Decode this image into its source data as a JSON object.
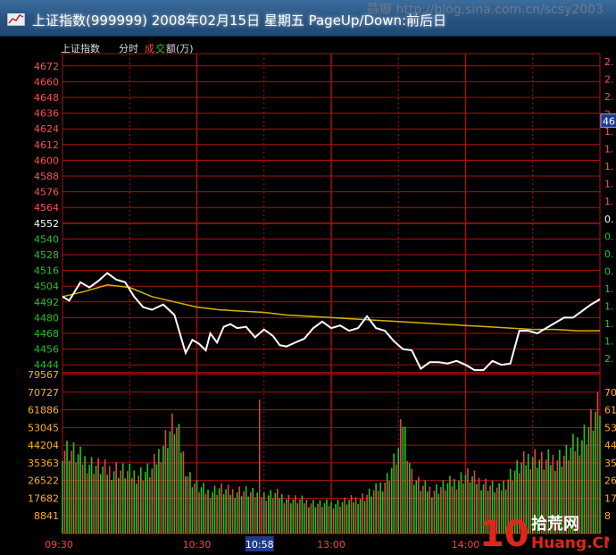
{
  "window": {
    "title": "上证指数(999999) 2008年02月15日 星期五 PageUp/Down:前后日",
    "watermark": "蒜瓣 http://blog.sina.com.cn/scsy2003"
  },
  "header": {
    "name": "上证指数",
    "mode": "分时",
    "vol_a": "成",
    "vol_b": "交",
    "vol_c": "额(万)"
  },
  "right_axis_fragments": {
    "price": [
      "2.",
      "2.",
      "2.",
      "2.",
      "1.",
      "1.",
      "1.",
      "1.",
      "1.",
      "0.",
      "0.",
      "0.",
      "0.",
      "1.",
      "1.",
      "1.",
      "1.",
      "2."
    ],
    "volume": [
      "70",
      "61",
      "53",
      "44",
      "35",
      "26",
      "17",
      "8"
    ],
    "price_badge": "46"
  },
  "logo": {
    "numeral": "10",
    "top": "拾荒网",
    "bottom": "Huang.CN"
  },
  "chart_data": {
    "type": "line",
    "price_axis_ticks": [
      4672,
      4660,
      4648,
      4636,
      4624,
      4612,
      4600,
      4588,
      4576,
      4564,
      4552,
      4540,
      4528,
      4516,
      4504,
      4492,
      4480,
      4468,
      4456,
      4444
    ],
    "reference_price": 4552,
    "volume_axis_ticks": [
      79567,
      70727,
      61886,
      53045,
      44204,
      35363,
      26522,
      17682,
      8841
    ],
    "time_labels": [
      "09:30",
      "10:30",
      "10:58",
      "13:00",
      "14:00"
    ],
    "highlighted_time": "10:58",
    "ylim_price": [
      4438,
      4678
    ],
    "ylim_volume": [
      0,
      79567
    ],
    "grid": true,
    "colors": {
      "background": "#000000",
      "grid": "#b01010",
      "price_line": "#ffffff",
      "average_line": "#d6b400",
      "volume_up": "#d84848",
      "volume_down": "#27c21e",
      "axis_up": "#ff5050",
      "axis_down": "#27c21e",
      "axis_flat": "#ffffff"
    },
    "series": [
      {
        "key": "price",
        "x": [
          0,
          3,
          8,
          12,
          16,
          20,
          24,
          28,
          32,
          36,
          40,
          45,
          50,
          55,
          58,
          61,
          64,
          66,
          69,
          72,
          75,
          78,
          82,
          86,
          90,
          94,
          97,
          100,
          104,
          108,
          112,
          116,
          120,
          124,
          128,
          132,
          136,
          140,
          144,
          148,
          152,
          156,
          160,
          164,
          168,
          172,
          176,
          180,
          184,
          188,
          192,
          196,
          200,
          204,
          208,
          212,
          216,
          220,
          224,
          228,
          232,
          236,
          240
        ],
        "values": [
          4496,
          4493,
          4507,
          4503,
          4508,
          4514,
          4509,
          4507,
          4496,
          4488,
          4486,
          4490,
          4482,
          4453,
          4463,
          4460,
          4455,
          4468,
          4461,
          4473,
          4475,
          4472,
          4473,
          4465,
          4471,
          4466,
          4459,
          4458,
          4461,
          4464,
          4472,
          4477,
          4472,
          4474,
          4470,
          4472,
          4481,
          4472,
          4470,
          4462,
          4456,
          4455,
          4441,
          4446,
          4446,
          4445,
          4447,
          4444,
          4440,
          4440,
          4447,
          4444,
          4445,
          4470,
          4470,
          4468,
          4472,
          4476,
          4480,
          4480,
          4485,
          4490,
          4494
        ]
      },
      {
        "key": "average",
        "x": [
          0,
          10,
          20,
          30,
          40,
          50,
          60,
          70,
          80,
          90,
          100,
          110,
          120,
          130,
          140,
          150,
          160,
          170,
          180,
          190,
          200,
          210,
          220,
          230,
          240
        ],
        "values": [
          4496,
          4500,
          4505,
          4503,
          4496,
          4492,
          4488,
          4486,
          4485,
          4484,
          4482,
          4481,
          4480,
          4479,
          4478,
          4477,
          4476,
          4475,
          4474,
          4473,
          4472,
          4471,
          4471,
          4470,
          4470
        ]
      },
      {
        "key": "volume",
        "profile": [
          [
            0,
            44000
          ],
          [
            4,
            42000
          ],
          [
            8,
            38000
          ],
          [
            12,
            36000
          ],
          [
            16,
            34000
          ],
          [
            20,
            32000
          ],
          [
            24,
            33000
          ],
          [
            28,
            31000
          ],
          [
            32,
            30000
          ],
          [
            36,
            31000
          ],
          [
            40,
            32000
          ],
          [
            45,
            46000
          ],
          [
            50,
            56000
          ],
          [
            53,
            44000
          ],
          [
            56,
            30000
          ],
          [
            60,
            24000
          ],
          [
            65,
            21000
          ],
          [
            70,
            23000
          ],
          [
            75,
            21000
          ],
          [
            80,
            22000
          ],
          [
            85,
            20000
          ],
          [
            90,
            19000
          ],
          [
            95,
            20000
          ],
          [
            100,
            18000
          ],
          [
            105,
            17000
          ],
          [
            110,
            16000
          ],
          [
            115,
            15000
          ],
          [
            120,
            15000
          ],
          [
            125,
            16000
          ],
          [
            130,
            17000
          ],
          [
            135,
            19000
          ],
          [
            140,
            22000
          ],
          [
            145,
            28000
          ],
          [
            148,
            36000
          ],
          [
            150,
            42000
          ],
          [
            152,
            58000
          ],
          [
            154,
            44000
          ],
          [
            156,
            30000
          ],
          [
            160,
            24000
          ],
          [
            165,
            22000
          ],
          [
            170,
            24000
          ],
          [
            175,
            26000
          ],
          [
            180,
            30000
          ],
          [
            185,
            27000
          ],
          [
            190,
            25000
          ],
          [
            195,
            22000
          ],
          [
            200,
            30000
          ],
          [
            205,
            35000
          ],
          [
            210,
            40000
          ],
          [
            215,
            36000
          ],
          [
            220,
            38000
          ],
          [
            225,
            40000
          ],
          [
            230,
            46000
          ],
          [
            234,
            52000
          ],
          [
            238,
            60000
          ],
          [
            240,
            64000
          ]
        ],
        "spike": {
          "x": 88,
          "value": 67000
        }
      }
    ]
  }
}
